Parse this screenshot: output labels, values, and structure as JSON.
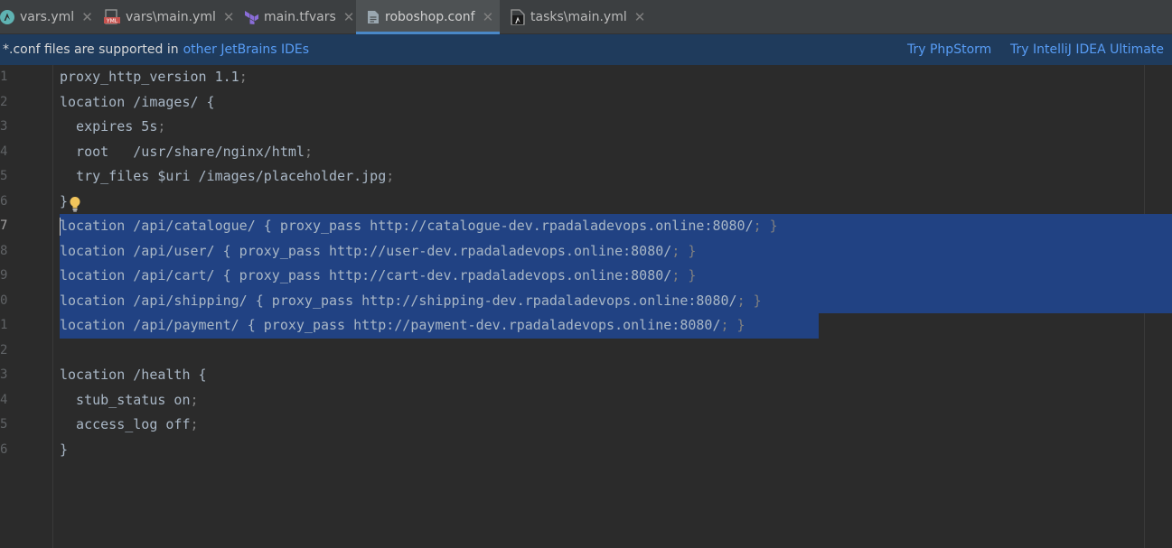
{
  "tabs": [
    {
      "label": "vars.yml",
      "icon": "ansible-icon",
      "active": false
    },
    {
      "label": "vars\\main.yml",
      "icon": "yml-file-icon",
      "active": false
    },
    {
      "label": "main.tfvars",
      "icon": "terraform-icon",
      "active": false
    },
    {
      "label": "roboshop.conf",
      "icon": "text-file-icon",
      "active": true
    },
    {
      "label": "tasks\\main.yml",
      "icon": "ansible-file-icon",
      "active": false
    }
  ],
  "banner": {
    "message": "*.conf files are supported in",
    "link": "other JetBrains IDEs",
    "actions": [
      "Try PhpStorm",
      "Try IntelliJ IDEA Ultimate"
    ]
  },
  "editor": {
    "current_line": 7,
    "line_numbers": [
      "1",
      "2",
      "3",
      "4",
      "5",
      "6",
      "7",
      "8",
      "9",
      "0",
      "1",
      "2",
      "3",
      "4",
      "5",
      "6"
    ],
    "lines": [
      {
        "text": "proxy_http_version 1.1",
        "semi": ";"
      },
      {
        "text": "location /images/ {",
        "semi": ""
      },
      {
        "text": "  expires 5s",
        "semi": ";"
      },
      {
        "text": "  root   /usr/share/nginx/html",
        "semi": ";"
      },
      {
        "text": "  try_files $uri /images/placeholder.jpg",
        "semi": ";"
      },
      {
        "text": "}",
        "semi": ""
      },
      {
        "text": "location /api/catalogue/ { proxy_pass http://catalogue-dev.rpadaladevops.online:8080/",
        "semi": "; }"
      },
      {
        "text": "location /api/user/ { proxy_pass http://user-dev.rpadaladevops.online:8080/",
        "semi": "; }"
      },
      {
        "text": "location /api/cart/ { proxy_pass http://cart-dev.rpadaladevops.online:8080/",
        "semi": "; }"
      },
      {
        "text": "location /api/shipping/ { proxy_pass http://shipping-dev.rpadaladevops.online:8080/",
        "semi": "; }"
      },
      {
        "text": "location /api/payment/ { proxy_pass http://payment-dev.rpadaladevops.online:8080/",
        "semi": "; }"
      },
      {
        "text": "",
        "semi": ""
      },
      {
        "text": "location /health {",
        "semi": ""
      },
      {
        "text": "  stub_status on",
        "semi": ";"
      },
      {
        "text": "  access_log off",
        "semi": ";"
      },
      {
        "text": "}",
        "semi": ""
      }
    ]
  },
  "colors": {
    "accent": "#4a88c7",
    "selection": "#214283",
    "banner_bg": "#1f3b5c",
    "link": "#589df6"
  }
}
